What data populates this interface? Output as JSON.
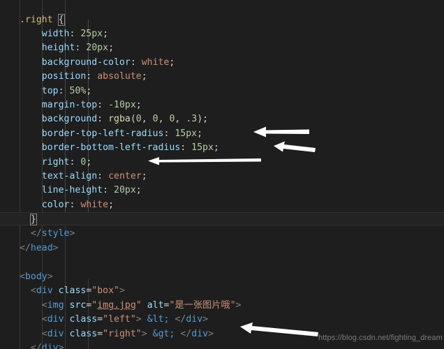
{
  "editor": {
    "theme": "dark-plus",
    "background_color": "#1e1e1e",
    "current_line_color": "#232323"
  },
  "colors": {
    "selector": "#d7ba7d",
    "property": "#9cdcfe",
    "number": "#b5cea8",
    "value_keyword": "#ce9178",
    "function": "#dcdcaa",
    "tag": "#569cd6",
    "string": "#ce9178",
    "punctuation": "#d4d4d4",
    "tag_punctuation": "#808080",
    "entity": "#569cd6",
    "indent_guide": "#3b3b3b",
    "arrow": "#ffffff",
    "watermark": "#7c7c7c"
  },
  "code": {
    "language": "html-with-css",
    "lines": [
      {
        "n": 1,
        "text": ".right {"
      },
      {
        "n": 2,
        "text": "    width: 25px;"
      },
      {
        "n": 3,
        "text": "    height: 20px;"
      },
      {
        "n": 4,
        "text": "    background-color: white;"
      },
      {
        "n": 5,
        "text": "    position: absolute;"
      },
      {
        "n": 6,
        "text": "    top: 50%;"
      },
      {
        "n": 7,
        "text": "    margin-top: -10px;"
      },
      {
        "n": 8,
        "text": "    background: rgba(0, 0, 0, .3);"
      },
      {
        "n": 9,
        "text": "    border-top-left-radius: 15px;"
      },
      {
        "n": 10,
        "text": "    border-bottom-left-radius: 15px;"
      },
      {
        "n": 11,
        "text": "    right: 0;"
      },
      {
        "n": 12,
        "text": "    text-align: center;"
      },
      {
        "n": 13,
        "text": "    line-height: 20px;"
      },
      {
        "n": 14,
        "text": "    color: white;"
      },
      {
        "n": 15,
        "text": "}"
      },
      {
        "n": 16,
        "text": "    </style>"
      },
      {
        "n": 17,
        "text": "</head>"
      },
      {
        "n": 18,
        "text": ""
      },
      {
        "n": 19,
        "text": "<body>"
      },
      {
        "n": 20,
        "text": "    <div class=\"box\">"
      },
      {
        "n": 21,
        "text": "        <img src=\"img.jpg\" alt=\"是一张图片哦\">"
      },
      {
        "n": 22,
        "text": "        <div class=\"left\"> &lt; </div>"
      },
      {
        "n": 23,
        "text": "        <div class=\"right\"> &gt; </div>"
      },
      {
        "n": 24,
        "text": "    </div>"
      }
    ]
  },
  "tokens": {
    "l1_selector": ".right",
    "l1_brace": "{",
    "l2_prop": "width",
    "l2_num": "25px",
    "l3_prop": "height",
    "l3_num": "20px",
    "l4_prop": "background-color",
    "l4_val": "white",
    "l5_prop": "position",
    "l5_val": "absolute",
    "l6_prop": "top",
    "l6_num": "50%",
    "l7_prop": "margin-top",
    "l7_num": "-10px",
    "l8_prop": "background",
    "l8_fn": "rgba",
    "l8_a": "0",
    "l8_b": "0",
    "l8_c": "0",
    "l8_d": ".3",
    "l9_prop": "border-top-left-radius",
    "l9_num": "15px",
    "l10_prop": "border-bottom-left-radius",
    "l10_num": "15px",
    "l11_prop": "right",
    "l11_num": "0",
    "l12_prop": "text-align",
    "l12_val": "center",
    "l13_prop": "line-height",
    "l13_num": "20px",
    "l14_prop": "color",
    "l14_val": "white",
    "l15_brace": "}",
    "l16_tag": "style",
    "l17_tag": "head",
    "l19_tag": "body",
    "l20_tag": "div",
    "l20_attr": "class",
    "l20_val": "\"box\"",
    "l21_tag": "img",
    "l21_attr1": "src",
    "l21_val1": "img.jpg",
    "l21_attr2": "alt",
    "l21_val2": "是一张图片哦",
    "l22_tag": "div",
    "l22_attr": "class",
    "l22_val": "\"left\"",
    "l22_entity": "&lt;",
    "l23_tag": "div",
    "l23_attr": "class",
    "l23_val": "\"right\"",
    "l23_entity": "&gt;",
    "l24_tag": "div"
  },
  "annotations": {
    "arrows": [
      {
        "id": "arrow-border-top-left-radius",
        "target_line": 9,
        "direction": "left",
        "length": 64,
        "style": "thick"
      },
      {
        "id": "arrow-border-bottom-left-radius",
        "target_line": 10,
        "direction": "left",
        "length": 64,
        "style": "thick"
      },
      {
        "id": "arrow-right-zero",
        "target_line": 11,
        "direction": "left",
        "length": 158,
        "style": "thin"
      },
      {
        "id": "arrow-div-right",
        "target_line": 23,
        "direction": "left",
        "length": 110,
        "style": "thick"
      }
    ]
  },
  "watermark": {
    "text": "https://blog.csdn.net/fighting_dream"
  }
}
